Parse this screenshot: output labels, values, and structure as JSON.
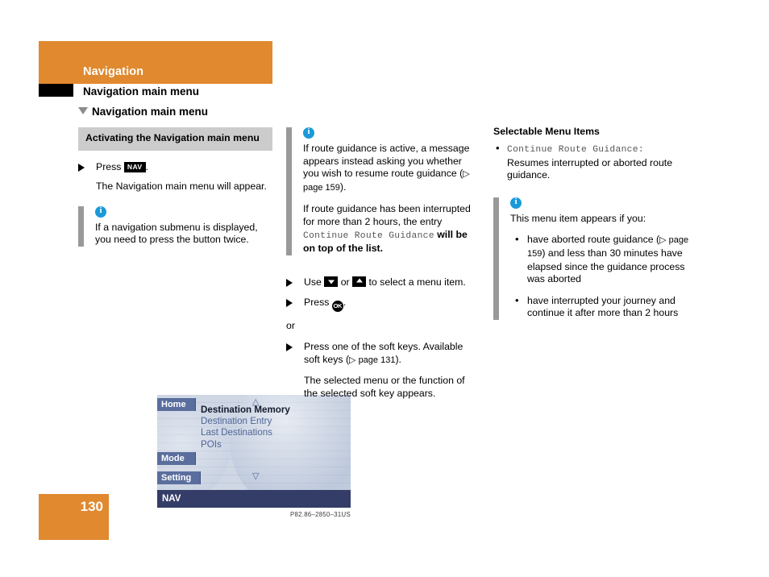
{
  "header": {
    "chapter_tab": "Navigation",
    "chapter_title": "Navigation main menu",
    "section_title": "Navigation main menu",
    "orange_hex": "#e0892f"
  },
  "column1": {
    "subhead": "Activating the Navigation main menu",
    "step_press_prefix": "Press",
    "key_nav_label": "NAV",
    "step_press_suffix": ".",
    "step_result": "The Navigation main menu will appear.",
    "note": {
      "icon": "info-icon",
      "text": "If a navigation submenu is displayed, you need to press the button twice."
    },
    "figure": {
      "softkeys": [
        "Home",
        "Mode",
        "Setting"
      ],
      "menu_items": [
        {
          "label": "Destination Memory",
          "selected": true
        },
        {
          "label": "Destination Entry",
          "selected": false
        },
        {
          "label": "Last Destinations",
          "selected": false
        },
        {
          "label": "POIs",
          "selected": false
        }
      ],
      "scroll_up_glyph": "△",
      "scroll_down_glyph": "▽",
      "status_bar": "NAV",
      "caption": "P82.86–2850–31US",
      "softkey_hex": "#5a6e9d",
      "statusbar_hex": "#343d68"
    }
  },
  "column2": {
    "note": {
      "icon": "info-icon",
      "para1_a": "If route guidance is active, a message appears instead asking you whether you wish to resume route guidance (",
      "para1_ref": "▷ page 159",
      "para1_b": ").",
      "para2_a": "If route guidance has been interrupted for more than 2 hours, the entry ",
      "para2_mono": "Continue Route Guidance",
      "para2_b": " will be on top of the list."
    },
    "step_use_a": "Use",
    "step_use_or": "or",
    "step_use_b": "to select a menu item.",
    "step_press_ok_a": "Press",
    "key_ok_label": "OK",
    "step_press_ok_b": ".",
    "or_label": "or",
    "step_softkey_a": "Press one of the soft keys. Available soft keys (",
    "step_softkey_ref": "▷ page 131",
    "step_softkey_b": ").",
    "step_softkey_result": "The selected menu or the function of the selected soft key appears."
  },
  "column3": {
    "heading": "Selectable Menu Items",
    "item_mono": "Continue Route Guidance",
    "item_colon": ":",
    "item_desc": "Resumes interrupted or aborted route guidance.",
    "note": {
      "icon": "info-icon",
      "intro": "This menu item appears if you:",
      "bullets": [
        {
          "a": "have aborted route guidance (",
          "ref": "▷ page 159",
          "b": ") and less than 30 minutes have elapsed since the guidance process was aborted"
        },
        {
          "a": "have interrupted your journey and continue it after more than 2 hours",
          "ref": "",
          "b": ""
        }
      ]
    }
  },
  "footer": {
    "page_number": "130"
  }
}
